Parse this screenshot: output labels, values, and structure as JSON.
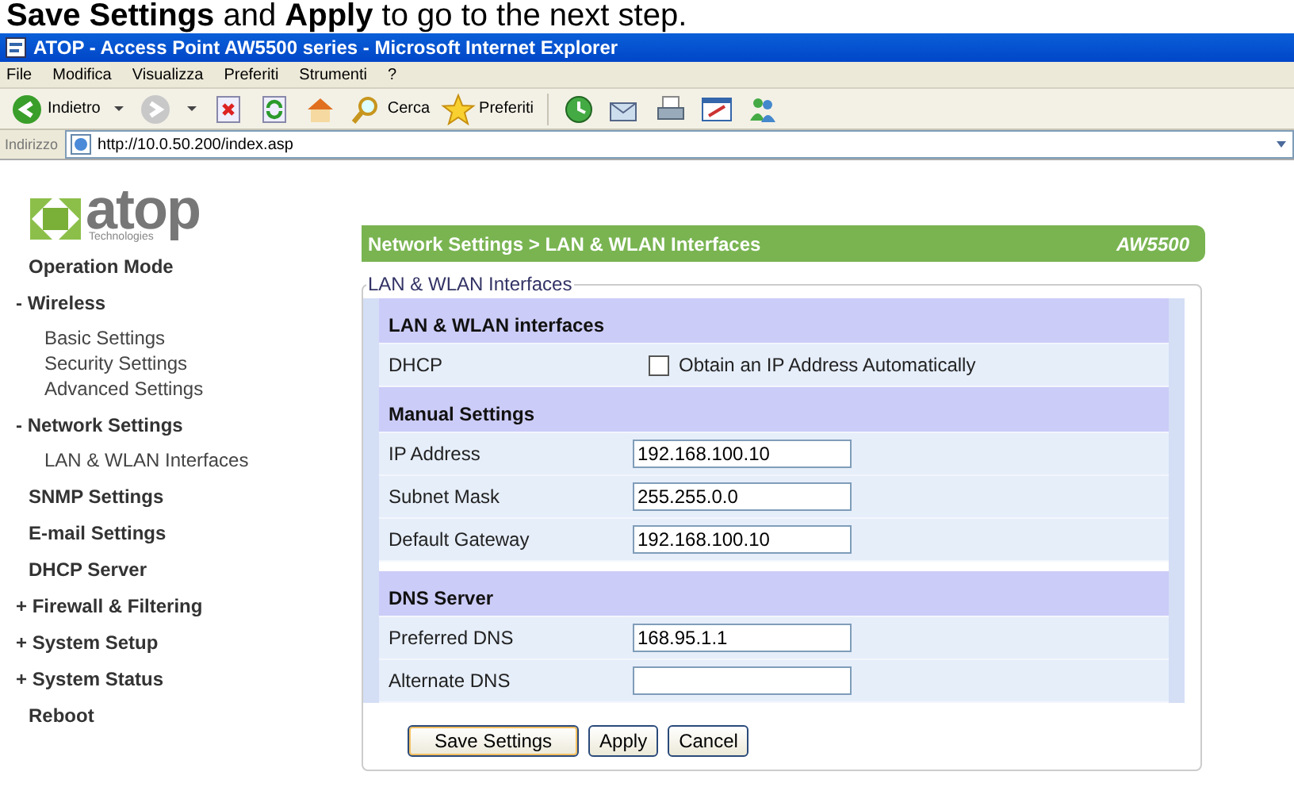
{
  "caption": "**Save Settings** and **Apply** to go to the next step.",
  "window": {
    "title": "ATOP - Access Point AW5500 series - Microsoft Internet Explorer"
  },
  "menu": [
    "File",
    "Modifica",
    "Visualizza",
    "Preferiti",
    "Strumenti",
    "?"
  ],
  "toolbar": [
    {
      "kind": "back",
      "label": "Indietro"
    },
    {
      "kind": "forward"
    },
    {
      "kind": "stop"
    },
    {
      "kind": "refresh"
    },
    {
      "kind": "home"
    },
    {
      "kind": "search",
      "label": "Cerca"
    },
    {
      "kind": "favorites",
      "label": "Preferiti"
    },
    {
      "kind": "history"
    },
    {
      "kind": "mail"
    },
    {
      "kind": "print"
    },
    {
      "kind": "edit"
    },
    {
      "kind": "messenger"
    }
  ],
  "address": {
    "label": "Indirizzo",
    "value": "http://10.0.50.200/index.asp"
  },
  "logo": {
    "name": "atop",
    "tagline": "Technologies"
  },
  "sidebar": [
    {
      "label": "Operation Mode"
    },
    {
      "marker": "-",
      "label": "Wireless",
      "children": [
        {
          "label": "Basic Settings"
        },
        {
          "label": "Security Settings"
        },
        {
          "label": "Advanced Settings"
        }
      ]
    },
    {
      "marker": "-",
      "label": "Network Settings",
      "children": [
        {
          "label": "LAN & WLAN Interfaces"
        }
      ]
    },
    {
      "label": "SNMP Settings"
    },
    {
      "label": "E-mail Settings"
    },
    {
      "label": "DHCP Server"
    },
    {
      "marker": "+",
      "label": "Firewall & Filtering"
    },
    {
      "marker": "+",
      "label": "System Setup"
    },
    {
      "marker": "+",
      "label": "System Status"
    },
    {
      "label": "Reboot"
    }
  ],
  "header": {
    "breadcrumb": "Network Settings > LAN & WLAN Interfaces",
    "model": "AW5500"
  },
  "fieldset": {
    "legend": "LAN & WLAN Interfaces",
    "rows": [
      {
        "kind": "section",
        "label": "LAN & WLAN interfaces"
      },
      {
        "kind": "checkbox",
        "label": "DHCP",
        "text": "Obtain an IP Address Automatically",
        "checked": false
      },
      {
        "kind": "section",
        "label": "Manual Settings"
      },
      {
        "kind": "input",
        "label": "IP Address",
        "value": "192.168.100.10"
      },
      {
        "kind": "input",
        "label": "Subnet Mask",
        "value": "255.255.0.0"
      },
      {
        "kind": "input",
        "label": "Default Gateway",
        "value": "192.168.100.10"
      },
      {
        "kind": "gap"
      },
      {
        "kind": "section",
        "label": "DNS Server"
      },
      {
        "kind": "input",
        "label": "Preferred DNS",
        "value": "168.95.1.1"
      },
      {
        "kind": "input",
        "label": "Alternate DNS"
      }
    ]
  },
  "buttons": [
    {
      "label": "Save Settings",
      "kind": "default"
    },
    {
      "label": "Apply"
    },
    {
      "label": "Cancel"
    }
  ]
}
